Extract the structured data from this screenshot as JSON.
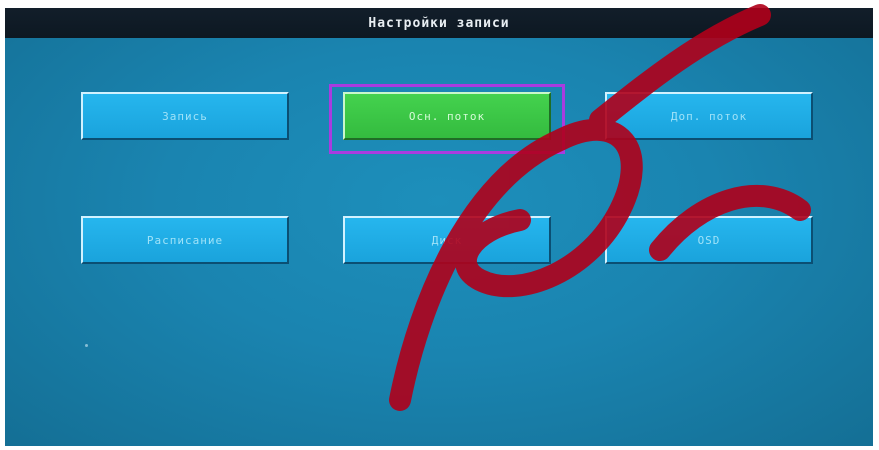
{
  "window": {
    "title": "Настройки записи"
  },
  "menu": {
    "buttons": [
      {
        "label": "Запись",
        "state": "normal"
      },
      {
        "label": "Осн. поток",
        "state": "selected"
      },
      {
        "label": "Доп. поток",
        "state": "normal"
      },
      {
        "label": "Расписание",
        "state": "normal"
      },
      {
        "label": "Диск",
        "state": "normal"
      },
      {
        "label": "OSD",
        "state": "normal"
      }
    ]
  },
  "colors": {
    "background": "#1a84b0",
    "button": "#1aa3dc",
    "button_selected": "#3fc648",
    "selection_frame": "#a83ce0",
    "title_bar": "#0d1822"
  }
}
